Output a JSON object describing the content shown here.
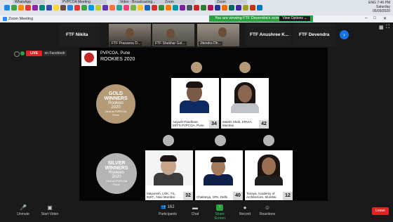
{
  "os": {
    "tabs": [
      "WhatsApp",
      "PVPCOA Meeting",
      "Video - Broadcasting...",
      "Zoom",
      "Zoom"
    ],
    "tray": {
      "lang": "ENG",
      "time": "7:46 PM",
      "day": "Saturday",
      "date": "05/09/2020"
    }
  },
  "zoom": {
    "title": "Zoom Meeting",
    "share_banner": "You are viewing FTF Devendra's screen",
    "view_options": "View Options ⌄",
    "participants_strip": [
      {
        "name": "FTF Nikita",
        "sub": ""
      },
      {
        "name": "",
        "sub": "FTF Prasanna D..."
      },
      {
        "name": "",
        "sub": "FTF Shekhar Gol..."
      },
      {
        "name": "",
        "sub": "Jitendra Dh..."
      },
      {
        "name": "FTF Anushree K...",
        "sub": ""
      },
      {
        "name": "FTF Devendra",
        "sub": ""
      }
    ],
    "live_label": "LIVE",
    "on_facebook": "on Facebook",
    "toolbar": {
      "unmute": "Unmute",
      "start_video": "Start Video",
      "participants": "Participants",
      "participants_count": "162",
      "chat": "Chat",
      "share_screen": "Share Screen",
      "record": "Record",
      "reactions": "Reactions",
      "leave": "Leave"
    }
  },
  "slide": {
    "org": "PVPCOA, Pune",
    "title": "ROOKIES 2020",
    "gold": {
      "line1": "GOLD",
      "line2": "WINNERS",
      "line3": "Rookies",
      "line4": "2020",
      "line5": "Held at PVPCOA",
      "line6": "Pune"
    },
    "silver": {
      "line1": "SILVER",
      "line2": "WINNERS",
      "line3": "Rookies",
      "line4": "2020",
      "line5": "Held at PVPCOA",
      "line6": "Pune"
    },
    "gold_winners": [
      {
        "caption": "Aayush Pandhare, MIT'S PVPCOA, Pune",
        "score": "34"
      },
      {
        "caption": "Sakshi Shah, KRVIA, Mumbai",
        "score": "42"
      }
    ],
    "silver_winners": [
      {
        "caption": "Mayuresh, LOK, TIL, INST., Navi Mumbai",
        "score": "32"
      },
      {
        "caption": "Chaitanya, SPA, Delhi",
        "score": "40"
      },
      {
        "caption": "Tanaya, Academy of Architecture, Mumbai",
        "score": "12"
      }
    ]
  },
  "colors": {
    "gold_circle": "#b49a76",
    "silver_circle": "#b5b5b5",
    "live": "#e02424",
    "share_green": "#2aa13e",
    "accent_blue": "#1573e5"
  }
}
